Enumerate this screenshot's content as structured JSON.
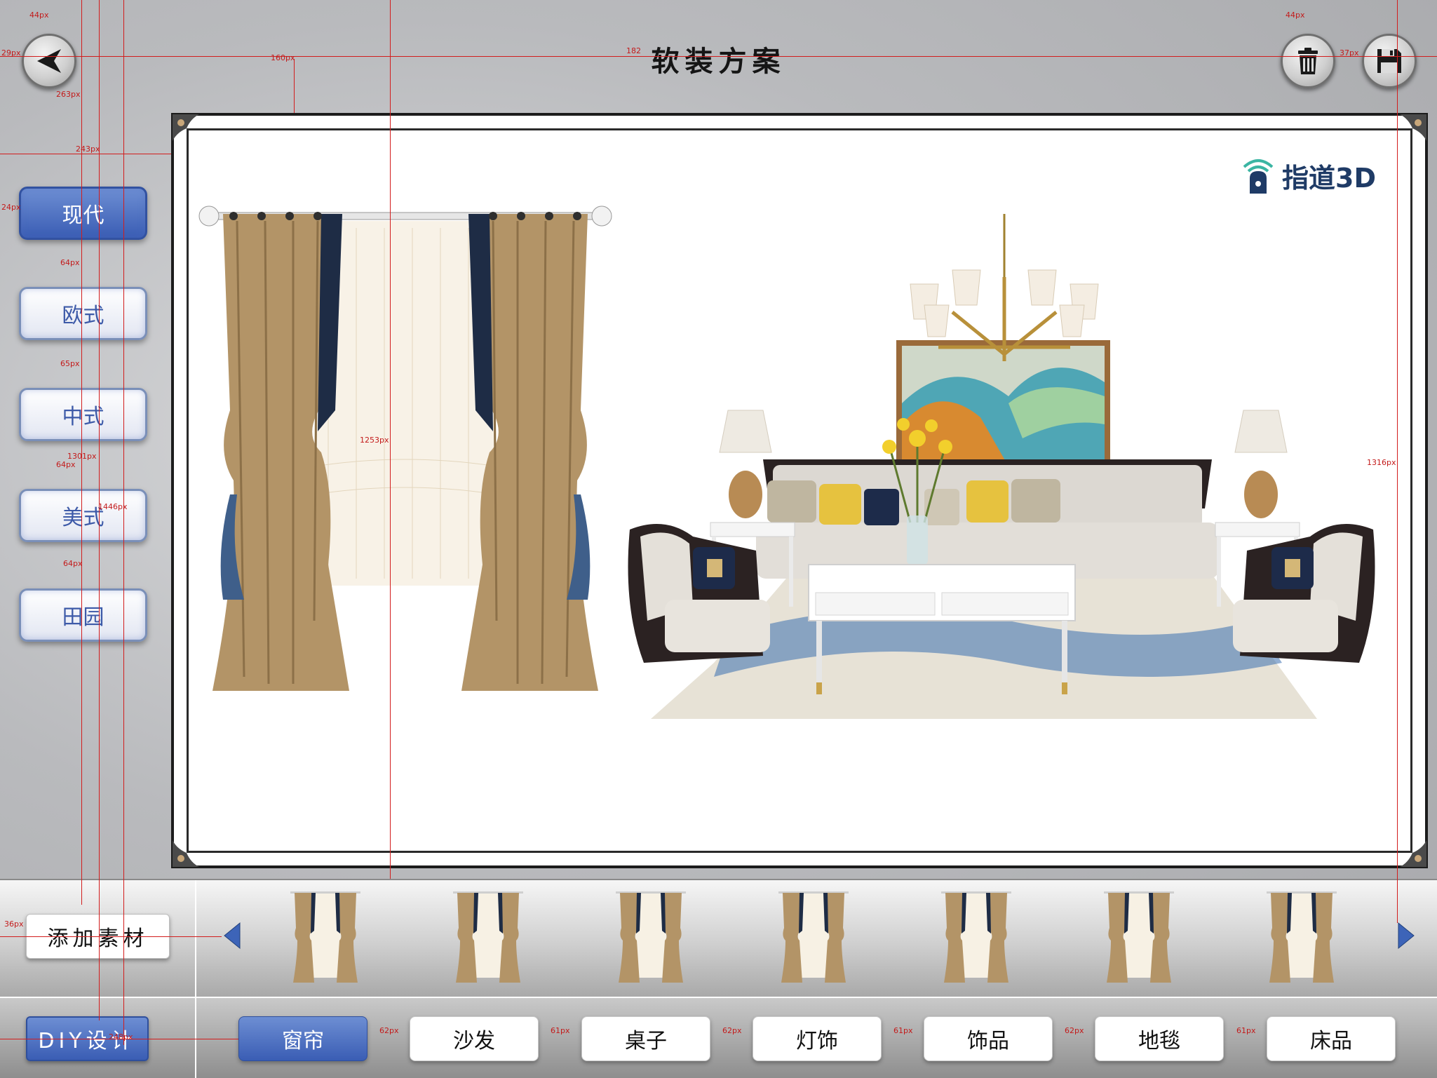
{
  "header": {
    "title": "软装方案"
  },
  "toolbar": {
    "back_icon": "back-arrow-icon",
    "delete_icon": "trash-icon",
    "save_icon": "save-icon"
  },
  "sidebar": {
    "styles": [
      {
        "label": "现代",
        "active": true
      },
      {
        "label": "欧式",
        "active": false
      },
      {
        "label": "中式",
        "active": false
      },
      {
        "label": "美式",
        "active": false
      },
      {
        "label": "田园",
        "active": false
      }
    ]
  },
  "canvas": {
    "watermark": "指道3D",
    "scene": [
      "curtain",
      "chandelier",
      "landscape-painting",
      "sofa",
      "armchair-left",
      "armchair-right",
      "side-table-lamp-left",
      "side-table-lamp-right",
      "coffee-table",
      "flower-vase",
      "rug"
    ]
  },
  "materials": {
    "add_label": "添加素材",
    "thumbnails": [
      "curtain",
      "curtain",
      "curtain",
      "curtain",
      "curtain",
      "curtain",
      "curtain"
    ],
    "prev_icon": "triangle-left-icon",
    "next_icon": "triangle-right-icon"
  },
  "footer": {
    "diy_label": "DIY设计",
    "categories": [
      {
        "label": "窗帘",
        "active": true
      },
      {
        "label": "沙发",
        "active": false
      },
      {
        "label": "桌子",
        "active": false
      },
      {
        "label": "灯饰",
        "active": false
      },
      {
        "label": "饰品",
        "active": false
      },
      {
        "label": "地毯",
        "active": false
      },
      {
        "label": "床品",
        "active": false
      }
    ]
  },
  "annotations": {
    "measurements": [
      "44px",
      "29px",
      "160px",
      "182",
      "263px",
      "243px",
      "24px",
      "64px",
      "65px",
      "64px",
      "1301px",
      "1446px",
      "64px",
      "1253px",
      "1316px",
      "44px",
      "37px",
      "36px",
      "248px",
      "62px",
      "61px",
      "62px",
      "61px",
      "62px",
      "61px"
    ]
  },
  "colors": {
    "accent": "#3a5db4",
    "accent_light": "#6d8ed3",
    "measure": "#d21d1d"
  }
}
